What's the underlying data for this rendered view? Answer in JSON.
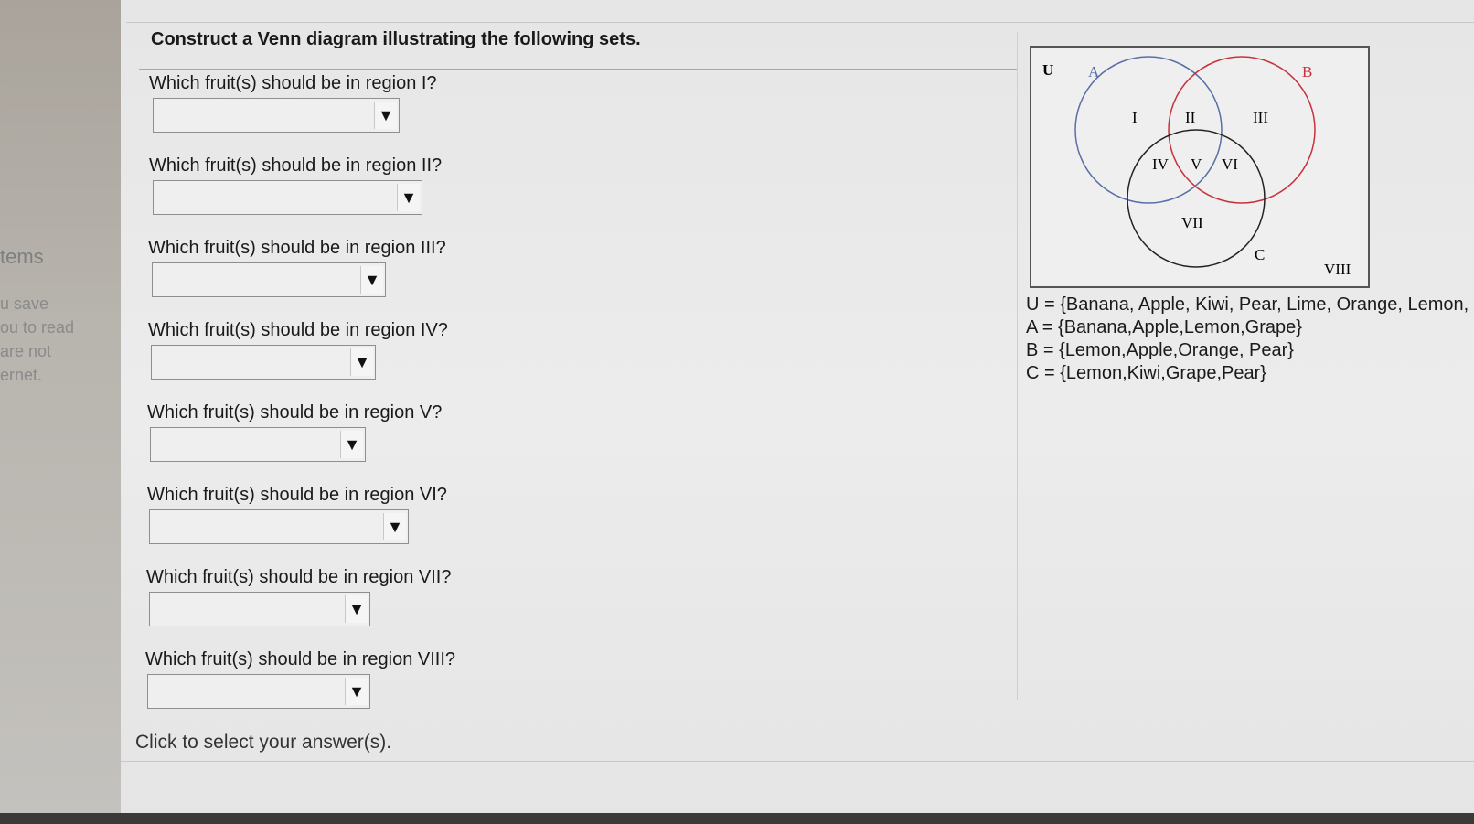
{
  "sidebar": {
    "title": "tems",
    "lines": [
      "u save",
      "ou to read",
      "are not",
      "ernet."
    ]
  },
  "heading": "Construct a Venn diagram illustrating the following sets.",
  "questions": [
    {
      "label": "Which fruit(s) should be in region I?",
      "value": ""
    },
    {
      "label": "Which fruit(s) should be in region II?",
      "value": ""
    },
    {
      "label": "Which fruit(s) should be in region III?",
      "value": ""
    },
    {
      "label": "Which fruit(s) should be in region IV?",
      "value": ""
    },
    {
      "label": "Which fruit(s) should be in region V?",
      "value": ""
    },
    {
      "label": "Which fruit(s) should be in region VI?",
      "value": ""
    },
    {
      "label": "Which fruit(s) should be in region VII?",
      "value": ""
    },
    {
      "label": "Which fruit(s) should be in region VIII?",
      "value": ""
    }
  ],
  "dropdown_arrow": "▼",
  "footer": "Click to select your answer(s).",
  "venn": {
    "universe_label": "U",
    "set_labels": {
      "A": "A",
      "B": "B",
      "C": "C"
    },
    "regions": [
      "I",
      "II",
      "III",
      "IV",
      "V",
      "VI",
      "VII",
      "VIII"
    ],
    "colors": {
      "A": "#5a6fa8",
      "B": "#c8323c",
      "C": "#222222"
    }
  },
  "sets": [
    "U = {Banana, Apple, Kiwi, Pear, Lime, Orange, Lemon,",
    "A = {Banana,Apple,Lemon,Grape}",
    "B = {Lemon,Apple,Orange, Pear}",
    "C = {Lemon,Kiwi,Grape,Pear}"
  ]
}
